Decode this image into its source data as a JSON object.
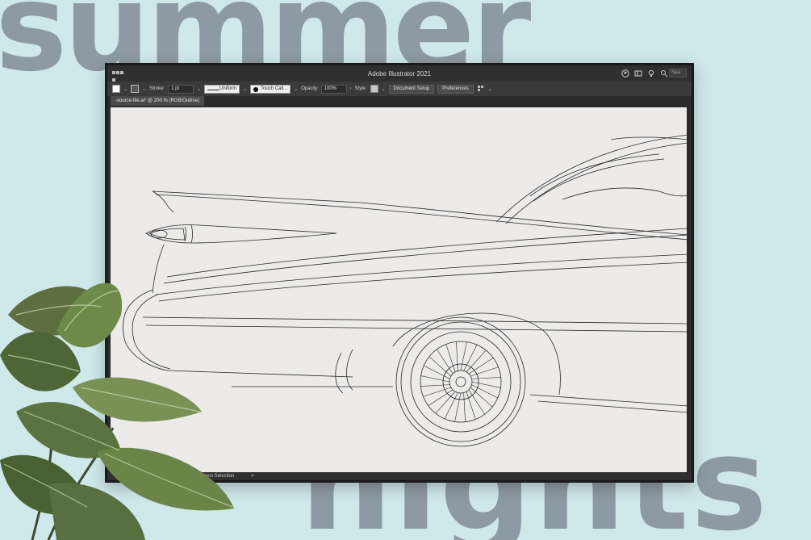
{
  "background": {
    "word_top": "summer",
    "word_bottom": "nights",
    "color": "#cfe8ea",
    "text_color": "#8e9aa3"
  },
  "window": {
    "title": "Adobe Illustrator 2021",
    "search_placeholder": "Sea"
  },
  "control_bar": {
    "stroke_label": "Stroke:",
    "stroke_value": "1 pt",
    "stroke_profile": "Uniform",
    "brush": "Touch Call...",
    "opacity_label": "Opacity",
    "opacity_value": "100%",
    "style_label": "Style:",
    "document_setup": "Document Setup",
    "preferences": "Preferences"
  },
  "document": {
    "tab_label": "-source-file.ai* @ 200 % (RGB/Outline)"
  },
  "status": {
    "tool": "Toggle Direct Selection",
    "arrow": ">"
  },
  "icons": [
    "app-menu-icon",
    "user-icon",
    "arrange-icon",
    "lightbulb-icon",
    "search-icon",
    "fill-swatch-icon",
    "stroke-swatch-icon",
    "brush-dot-icon",
    "arrange-docs-icon"
  ]
}
